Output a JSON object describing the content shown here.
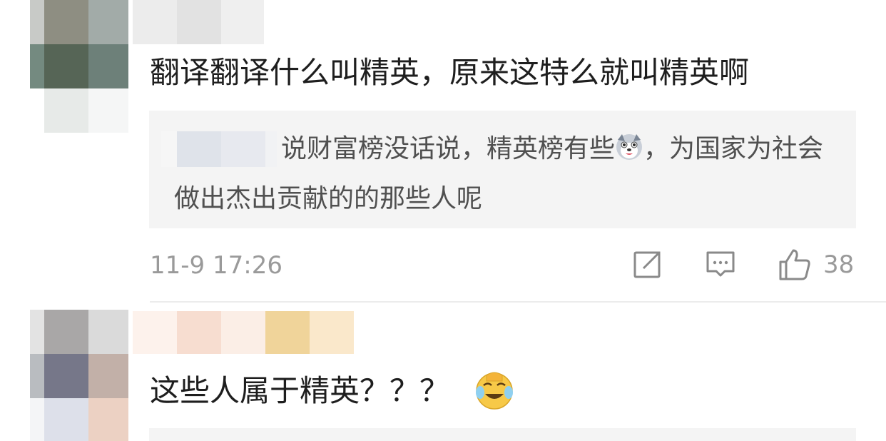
{
  "comments": [
    {
      "text": "翻译翻译什么叫精英，原来这特么就叫精英啊",
      "quote": {
        "text_before_emoji": "说财富榜没话说，精英榜有些",
        "emoji": "husky-dog-emoji",
        "text_after_emoji": "，为国家为社会做出杰出贡献的的那些人呢"
      },
      "time": "11-9 17:26",
      "likes": "38"
    },
    {
      "text": "这些人属于精英？？？",
      "emoji": "laughing-tears-emoji"
    }
  ],
  "colors": {
    "text": "#1e1e1e",
    "quote_text": "#505050",
    "meta": "#9a9a9a",
    "quote_bg": "#f4f4f4",
    "divider": "#ececec",
    "icon": "#8a8a8a"
  },
  "icons": {
    "repost": "repost-icon",
    "reply": "comment-icon",
    "like": "thumbs-up-icon"
  }
}
